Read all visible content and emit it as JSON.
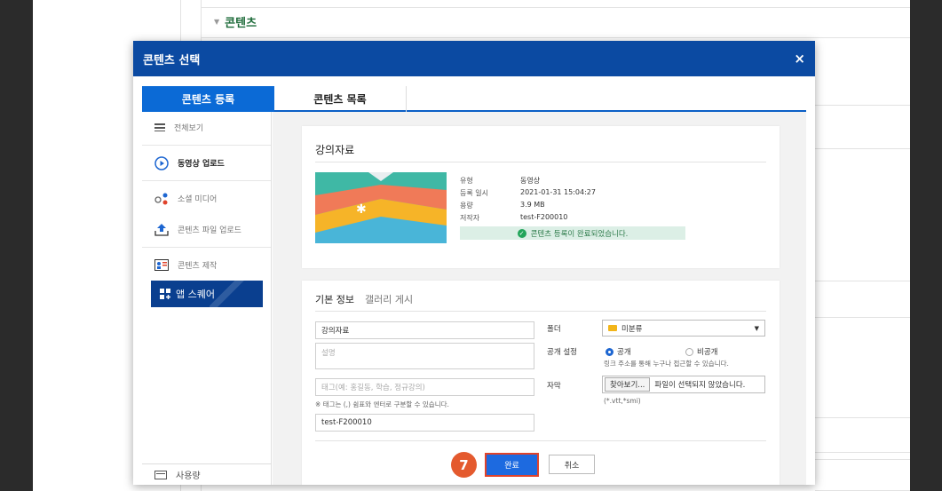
{
  "background": {
    "heading": "콘텐츠"
  },
  "modal": {
    "title": "콘텐츠 선택",
    "close_icon": "×",
    "tabs": [
      {
        "label": "콘텐츠 등록"
      },
      {
        "label": "콘텐츠 목록"
      }
    ]
  },
  "sidebar": {
    "items": [
      {
        "label": "전체보기",
        "icon": "list-icon"
      },
      {
        "label": "동영상 업로드",
        "icon": "play-circle-icon"
      },
      {
        "label": "소셜 미디어",
        "icon": "social-icon"
      },
      {
        "label": "콘텐츠 파일 업로드",
        "icon": "upload-icon"
      },
      {
        "label": "콘텐츠 제작",
        "icon": "create-icon"
      }
    ],
    "app_square": "앱 스퀘어",
    "usage": "사용량"
  },
  "content_card": {
    "title": "강의자료",
    "meta": [
      {
        "key": "유형",
        "value": "동영상"
      },
      {
        "key": "등록 일시",
        "value": "2021-01-31 15:04:27"
      },
      {
        "key": "용량",
        "value": "3.9 MB"
      },
      {
        "key": "저작자",
        "value": "test-F200010"
      }
    ],
    "status": "콘텐츠 등록이 완료되었습니다."
  },
  "form": {
    "tabs": [
      "기본 정보",
      "갤러리 게시"
    ],
    "title_value": "강의자료",
    "description_placeholder": "설명",
    "tags_placeholder": "태그(예: 홍길동, 학습, 정규강의)",
    "tags_hint": "※ 태그는 (,) 쉼표와 엔터로 구분할 수 있습니다.",
    "author_value": "test-F200010",
    "folder_label": "폴더",
    "folder_value": "미분류",
    "visibility_label": "공개 설정",
    "visibility_public": "공개",
    "visibility_private": "비공개",
    "visibility_hint": "링크 주소를 통해 누구나 접근할 수 있습니다.",
    "subtitle_label": "자막",
    "browse_button": "찾아보기...",
    "file_status": "파일이 선택되지 않았습니다.",
    "file_hint": "(*.vtt,*smi)",
    "ok_button": "완료",
    "cancel_button": "취소",
    "step_number": "7"
  },
  "colors": {
    "header": "#0b4aa2",
    "tab_active": "#0b6ad6",
    "ok_button": "#1d6ae0",
    "step_badge": "#e45a2e",
    "success": "#22a55a"
  }
}
